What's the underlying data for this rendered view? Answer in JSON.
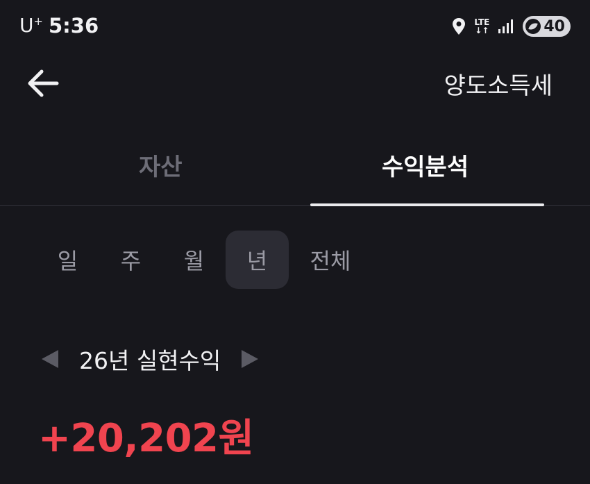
{
  "status_bar": {
    "carrier": "U",
    "carrier_sup": "+",
    "time": "5:36",
    "network": "LTE",
    "battery": "40"
  },
  "header": {
    "title": "양도소득세"
  },
  "tabs": [
    {
      "label": "자산",
      "active": false
    },
    {
      "label": "수익분석",
      "active": true
    }
  ],
  "periods": [
    {
      "label": "일",
      "active": false
    },
    {
      "label": "주",
      "active": false
    },
    {
      "label": "월",
      "active": false
    },
    {
      "label": "년",
      "active": true
    },
    {
      "label": "전체",
      "active": false
    }
  ],
  "profit": {
    "label": "26년 실현수익",
    "amount": "+20,202원"
  },
  "colors": {
    "background": "#17171c",
    "profit_red": "#f0444f",
    "tab_inactive": "#6d6d77",
    "period_active_bg": "#2c2c34"
  }
}
